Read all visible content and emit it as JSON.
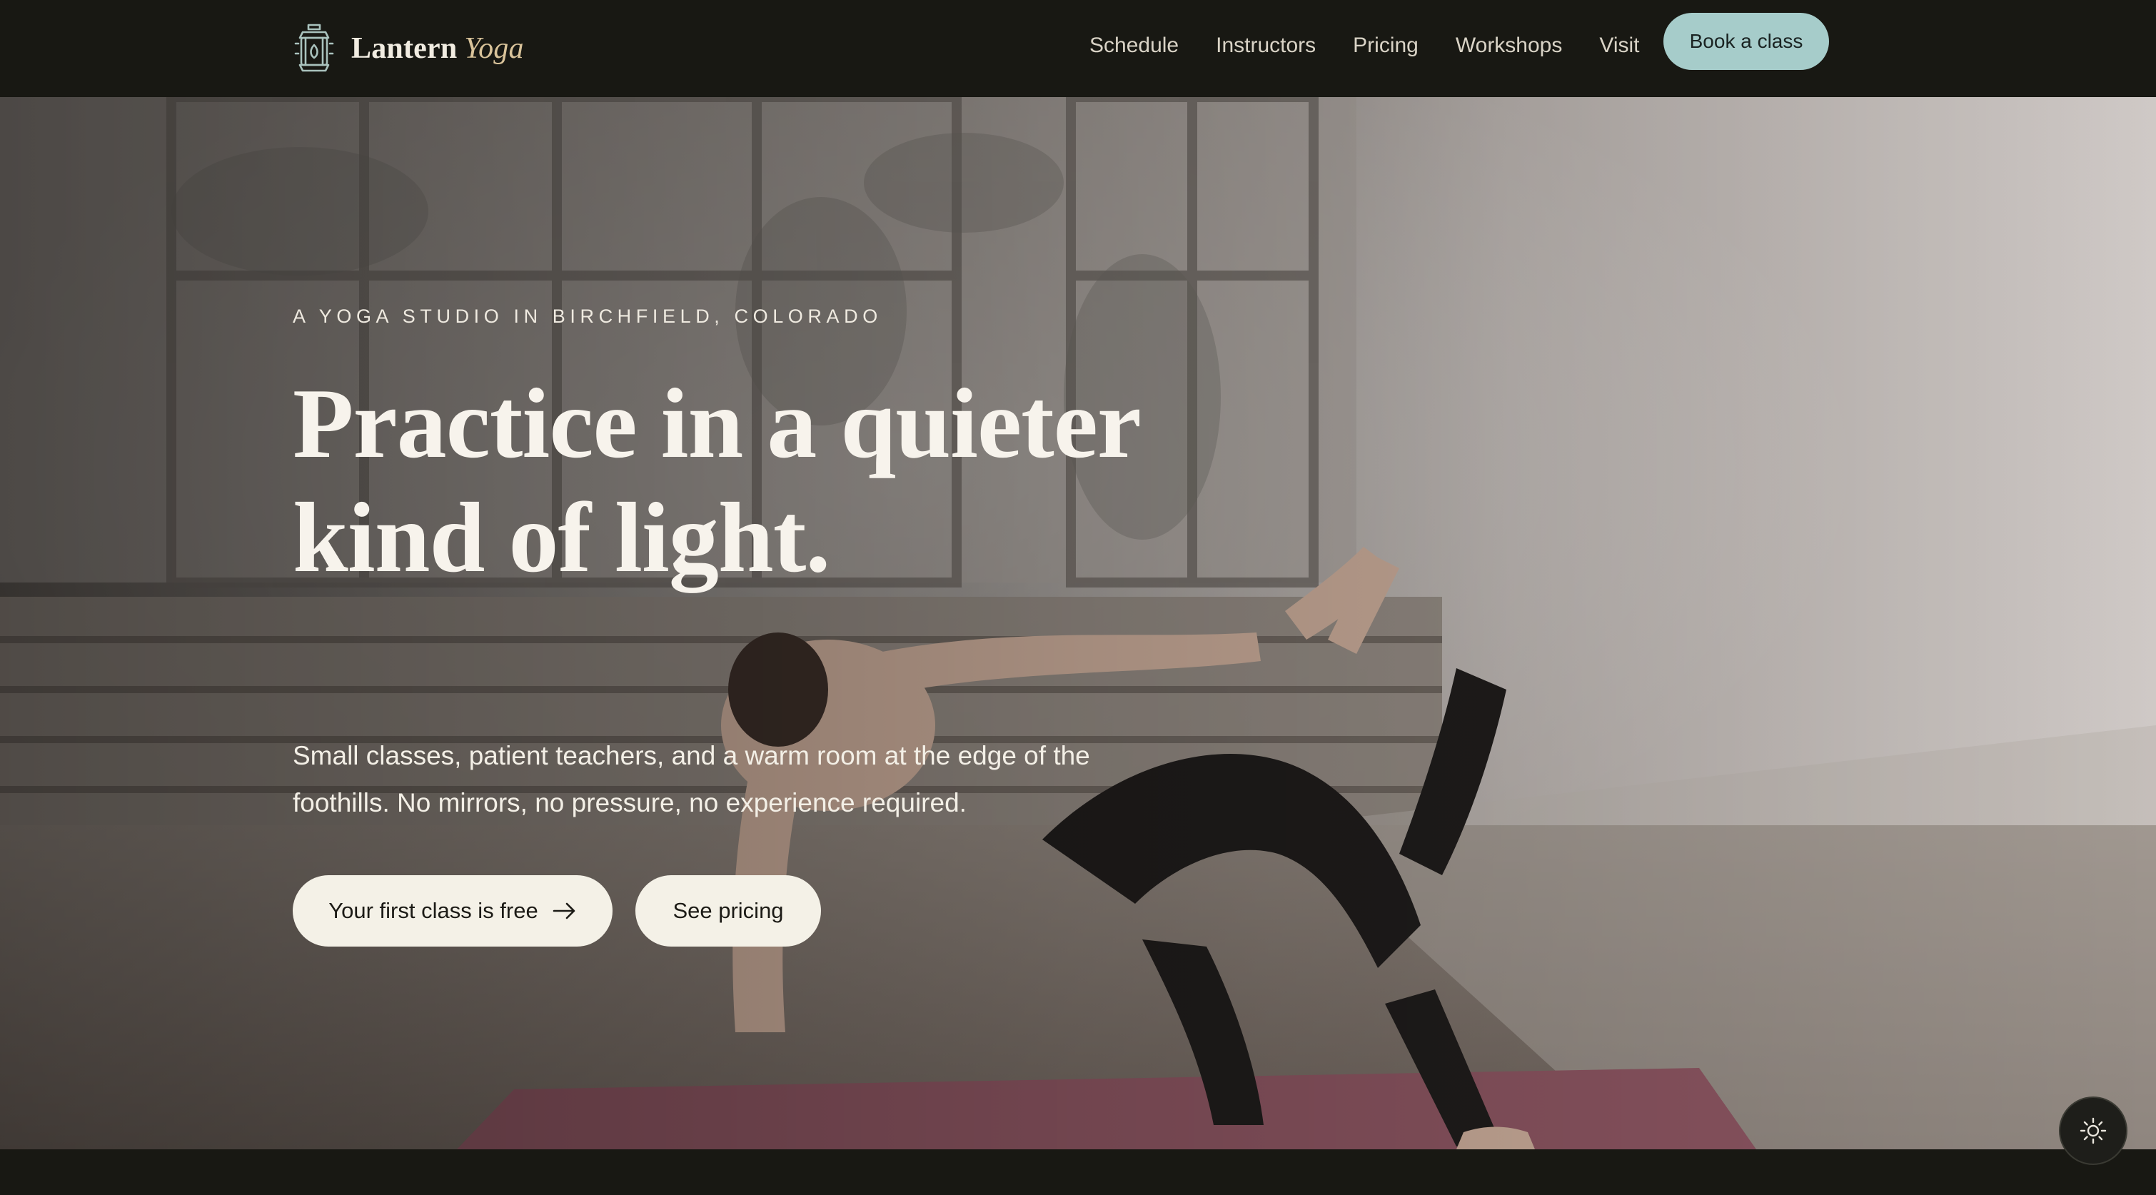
{
  "header": {
    "brand": {
      "name": "Lantern",
      "accent": "Yoga",
      "logo_icon": "lantern-icon"
    },
    "nav": [
      {
        "label": "Schedule"
      },
      {
        "label": "Instructors"
      },
      {
        "label": "Pricing"
      },
      {
        "label": "Workshops"
      },
      {
        "label": "Visit"
      }
    ],
    "cta_label": "Book a class"
  },
  "hero": {
    "eyebrow": "A YOGA STUDIO IN BIRCHFIELD, COLORADO",
    "headline": "Practice in a quieter kind of light.",
    "lede": "Small classes, patient teachers, and a warm room at the edge of the foothills. No mirrors, no pressure, no experience required.",
    "primary_cta": {
      "label": "Your first class is free",
      "icon": "arrow-right-icon"
    },
    "secondary_cta": {
      "label": "See pricing"
    },
    "background_image": "woman in a balancing yoga pose on a mat in a bright studio"
  },
  "theme_toggle": {
    "icon": "sun-icon"
  },
  "colors": {
    "page_background": "#181813",
    "accent": "#a6ccca",
    "brand_accent": "#d9c39a",
    "button_light": "#f4f1e7"
  }
}
